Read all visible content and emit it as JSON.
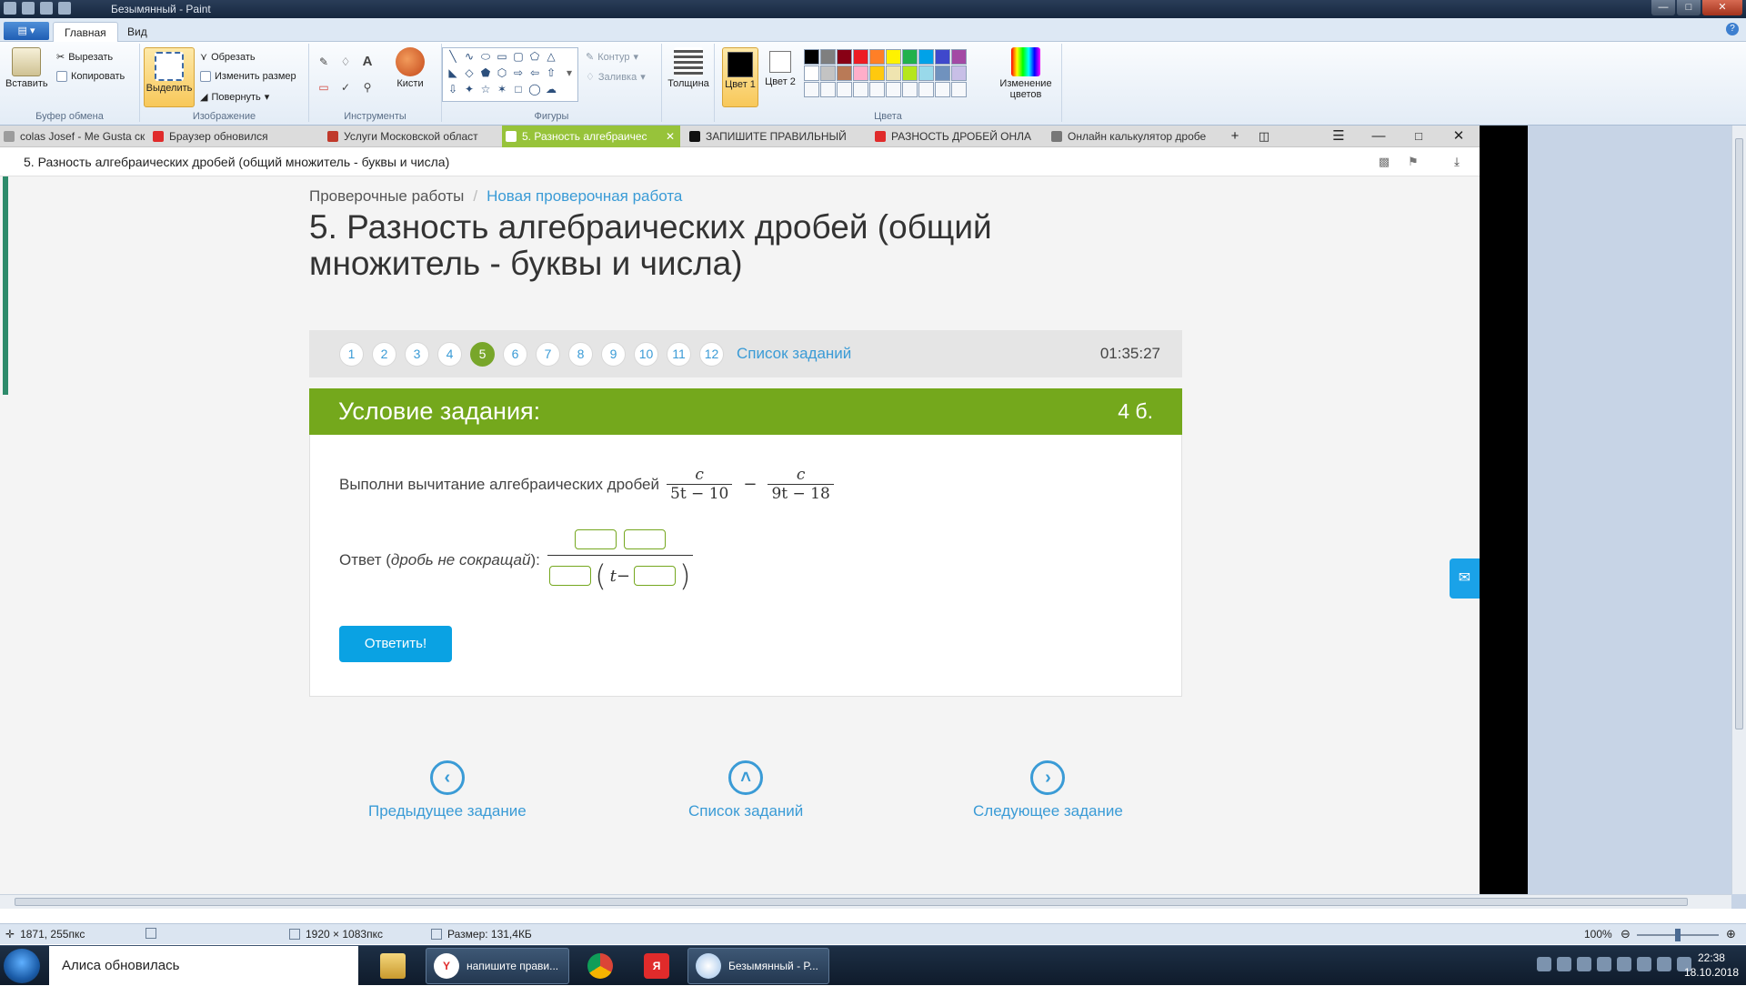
{
  "paint": {
    "window_title": "Безымянный - Paint",
    "tabs": [
      "Главная",
      "Вид"
    ],
    "groups": {
      "clipboard": {
        "name": "Буфер обмена",
        "paste": "Вставить",
        "cut": "Вырезать",
        "copy": "Копировать"
      },
      "image": {
        "name": "Изображение",
        "select": "Выделить",
        "crop": "Обрезать",
        "resize": "Изменить размер",
        "rotate": "Повернуть"
      },
      "tools": {
        "name": "Инструменты",
        "brushes": "Кисти"
      },
      "shapes": {
        "name": "Фигуры",
        "outline": "Контур",
        "fill": "Заливка"
      },
      "size": {
        "name": "Толщина"
      },
      "colors": {
        "name": "Цвета",
        "color1": "Цвет 1",
        "color2": "Цвет 2",
        "edit": "Изменение цветов",
        "palette": [
          "#000000",
          "#7f7f7f",
          "#880015",
          "#ed1c24",
          "#ff7f27",
          "#fff200",
          "#22b14c",
          "#00a2e8",
          "#3f48cc",
          "#a349a4",
          "#ffffff",
          "#c3c3c3",
          "#b97a57",
          "#ffaec9",
          "#ffc90e",
          "#efe4b0",
          "#b5e61d",
          "#99d9ea",
          "#7092be",
          "#c8bfe7"
        ]
      }
    },
    "status": {
      "cursor": "1871, 255пкс",
      "dimensions": "1920 × 1083пкс",
      "size": "Размер: 131,4КБ",
      "zoom": "100%"
    }
  },
  "browser": {
    "tabs": [
      {
        "label": "colas Josef - Me Gusta ск",
        "fav": "#9c9c9c"
      },
      {
        "label": "Браузер обновился",
        "fav": "#e02b2b"
      },
      {
        "label": "Услуги Московской област",
        "fav": "#c0392b"
      },
      {
        "label": "5. Разность алгебраичес",
        "fav": "#ffffff",
        "active": true
      },
      {
        "label": "ЗАПИШИТЕ ПРАВИЛЬНЫЙ",
        "fav": "#111111"
      },
      {
        "label": "РАЗНОСТЬ ДРОБЕЙ ОНЛА",
        "fav": "#e02b2b"
      },
      {
        "label": "Онлайн калькулятор дробе",
        "fav": "#777777"
      }
    ],
    "url_title": "5. Разность алгебраических дробей (общий множитель - буквы и числа)"
  },
  "page": {
    "breadcrumb": {
      "root": "Проверочные работы",
      "current": "Новая проверочная работа"
    },
    "title": "5. Разность алгебраических дробей (общий множитель - буквы и числа)",
    "questions": [
      "1",
      "2",
      "3",
      "4",
      "5",
      "6",
      "7",
      "8",
      "9",
      "10",
      "11",
      "12"
    ],
    "active_question": "5",
    "task_list": "Список заданий",
    "timer": "01:35:27",
    "condition_title": "Условие задания:",
    "points": "4 б.",
    "task_text": "Выполни вычитание алгебраических дробей",
    "frac1": {
      "num": "c",
      "den": "5t − 10"
    },
    "frac2": {
      "num": "c",
      "den": "9t − 18"
    },
    "minus": "−",
    "answer_label": "Ответ (",
    "answer_hint": "дробь не сокращай",
    "answer_end": "):",
    "answer_t": "t−",
    "submit": "Ответить!",
    "prev": "Предыдущее задание",
    "list": "Список заданий",
    "next": "Следующее задание"
  },
  "taskbar": {
    "alice": "Алиса обновилась",
    "items": [
      {
        "label": "напишите прави..."
      },
      {
        "label": "Безымянный - P..."
      }
    ],
    "clock_time": "22:38",
    "clock_date": "18.10.2018"
  }
}
